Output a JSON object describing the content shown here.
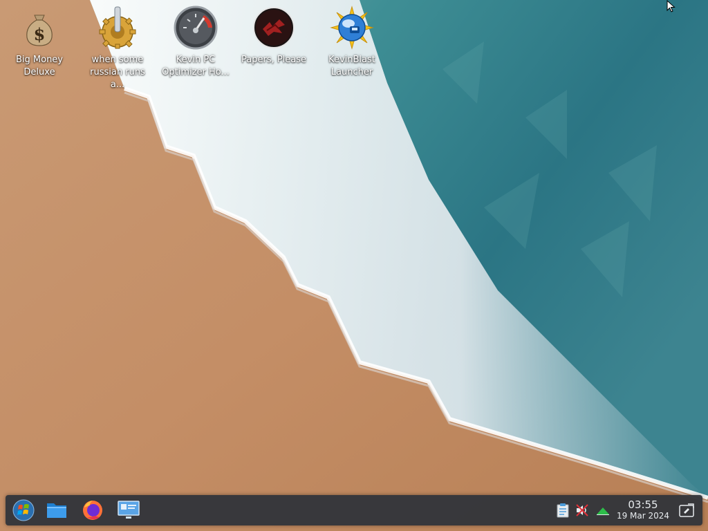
{
  "desktop": {
    "icons": [
      {
        "label": "Big Money\nDeluxe",
        "icon": "money-bag-icon"
      },
      {
        "label": "when some\nrussian runs a...",
        "icon": "gear-joystick-icon"
      },
      {
        "label": "Kevin PC\nOptimizer Ho...",
        "icon": "speedometer-icon"
      },
      {
        "label": "Papers, Please",
        "icon": "papers-please-emblem-icon"
      },
      {
        "label": "KevinBlast\nLauncher",
        "icon": "globe-sun-icon"
      }
    ]
  },
  "taskbar": {
    "launchers": [
      {
        "name": "Application Launcher",
        "icon": "start-orb-icon"
      },
      {
        "name": "File Manager",
        "icon": "folder-icon"
      },
      {
        "name": "Firefox",
        "icon": "firefox-icon"
      },
      {
        "name": "System Settings",
        "icon": "system-settings-icon"
      }
    ],
    "tray": [
      {
        "name": "clipboard",
        "icon": "clipboard-icon"
      },
      {
        "name": "audio muted",
        "icon": "audio-muted-icon"
      },
      {
        "name": "network",
        "icon": "network-icon"
      }
    ],
    "clock": {
      "time": "03:55",
      "date": "19 Mar 2024"
    },
    "show_desktop_icon": "show-desktop-icon"
  }
}
